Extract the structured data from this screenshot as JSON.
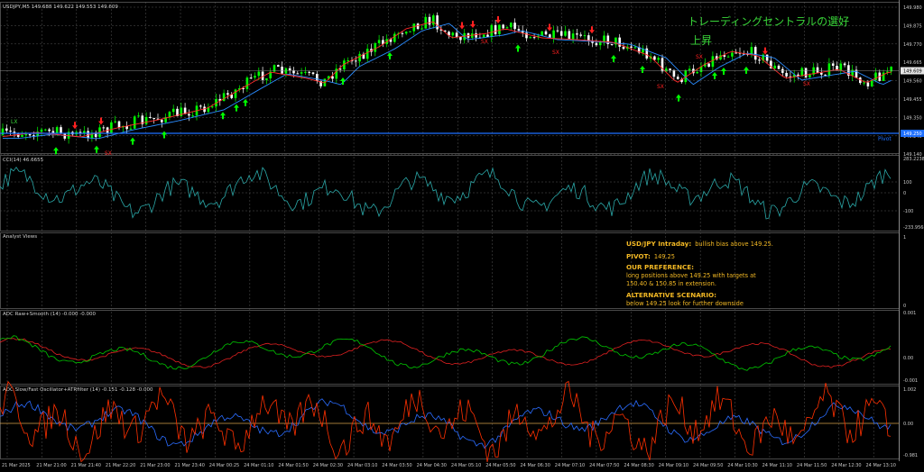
{
  "main_panel": {
    "title": "USDJPY,M5  149.688 149.622 149.553 149.609",
    "price_labels": [
      "149.980",
      "149.875",
      "149.770",
      "149.665",
      "149.560",
      "149.455",
      "149.350",
      "149.245",
      "149.140"
    ],
    "current_price": "149.609",
    "pivot_price": "149.250",
    "pivot_label": "Pivot",
    "jp_line1": "トレーディングセントラルの選好",
    "jp_line2": "上昇",
    "signal_labels": {
      "lx": "LX",
      "sx": "SX"
    },
    "colors": {
      "bull": "#00ff00",
      "bear": "#ffffff",
      "ma_fast": "#ff2a2a",
      "ma_slow": "#2a8cff",
      "pivot": "#1e6fff",
      "arrow_up": "#00ff00",
      "arrow_down": "#ff2020",
      "grid": "#5a5a5a"
    }
  },
  "cci_panel": {
    "title": "CCI(14) 46.6655",
    "levels": [
      "283.2238",
      "100",
      "0",
      "-100",
      "-233.9568"
    ],
    "color": "#2aa8a8"
  },
  "analyst_panel": {
    "title": "Analyst Views",
    "right_top": "1",
    "right_bottom": "0",
    "h1": "USD/JPY Intraday:",
    "h1_text": "bullish bias above 149.25.",
    "pivot_h": "PIVOT:",
    "pivot_val": "149.25",
    "pref_h": "OUR PREFERENCE:",
    "pref_line1": "long positions above 149.25 with targets at",
    "pref_line2": "150.40 & 150.85 in extension.",
    "alt_h": "ALTERNATIVE SCENARIO:",
    "alt_line1": "below 149.25 look for further downside"
  },
  "adc_raw_panel": {
    "title": "ADC Raw+Smooth (14) -0.000 -0.000",
    "levels": [
      "0.001",
      "0.00",
      "-0.001"
    ],
    "color_raw": "#00c800",
    "color_smooth": "#e02020"
  },
  "adc_slow_panel": {
    "title": "ADC Slow/Fast Oscillator+ATRfilter (14) -0.151 -0.128 -0.000",
    "levels": [
      "1.002",
      "0.00",
      "-0.981"
    ],
    "color_fast": "#ff3000",
    "color_slow": "#2a6cff",
    "color_zero": "#d4a04a"
  },
  "time_axis": [
    "21 Mar 2025",
    "21 Mar 21:00",
    "21 Mar 21:40",
    "21 Mar 22:20",
    "21 Mar 23:00",
    "21 Mar 23:40",
    "24 Mar 00:25",
    "24 Mar 01:10",
    "24 Mar 01:50",
    "24 Mar 02:30",
    "24 Mar 03:10",
    "24 Mar 03:50",
    "24 Mar 04:30",
    "24 Mar 05:10",
    "24 Mar 05:50",
    "24 Mar 06:30",
    "24 Mar 07:10",
    "24 Mar 07:50",
    "24 Mar 08:30",
    "24 Mar 09:10",
    "24 Mar 09:50",
    "24 Mar 10:30",
    "24 Mar 11:10",
    "24 Mar 11:50",
    "24 Mar 12:30",
    "24 Mar 13:10"
  ]
}
